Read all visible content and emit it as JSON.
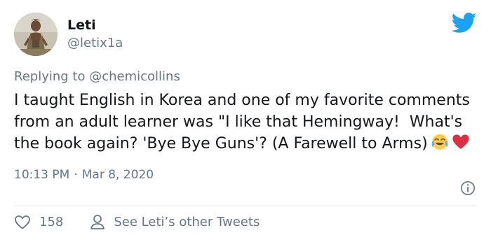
{
  "tweet": {
    "display_name": "Leti",
    "handle": "@letix1a",
    "replying_prefix": "Replying to",
    "replying_to": "@chemicollins",
    "text": "I taught English in Korea and one of my favorite comments from an adult learner was \"I like that Hemingway!  What's the book again? 'Bye Bye Guns'? (A Farewell to Arms)",
    "emojis": [
      "face-with-tears-of-joy-icon",
      "red-heart-icon"
    ],
    "time": "10:13 PM",
    "separator": "·",
    "date": "Mar 8, 2020",
    "like_count": "158",
    "other_tweets_label": "See Leti’s other Tweets"
  },
  "icons": {
    "brand": "twitter-bird-icon",
    "info": "info-icon",
    "like": "heart-outline-icon",
    "profile": "person-icon"
  },
  "colors": {
    "brand_blue": "#1da1f2",
    "text": "#14171a",
    "secondary": "#657786",
    "heart_red": "#e0245e",
    "divider": "#e1e8ed"
  }
}
